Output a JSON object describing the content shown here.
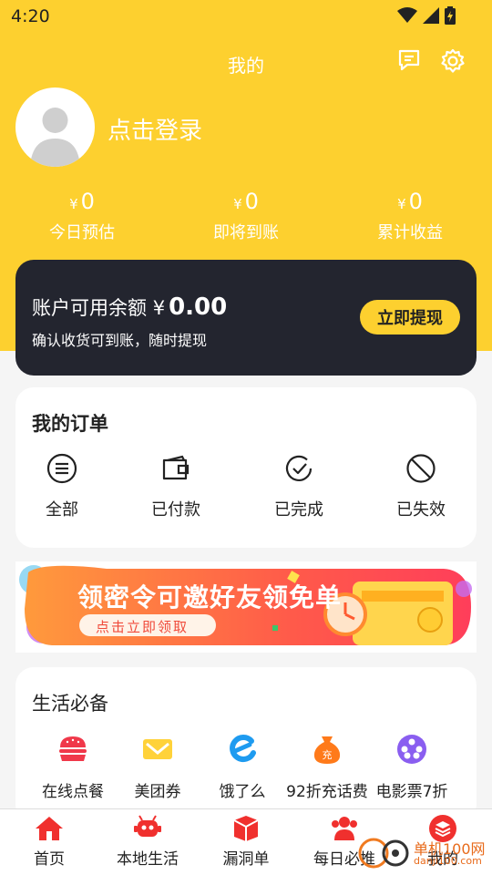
{
  "status_bar": {
    "time": "4:20"
  },
  "header": {
    "title": "我的"
  },
  "profile": {
    "login_text": "点击登录"
  },
  "stats": [
    {
      "currency": "¥",
      "value": "0",
      "label": "今日预估"
    },
    {
      "currency": "¥",
      "value": "0",
      "label": "即将到账"
    },
    {
      "currency": "¥",
      "value": "0",
      "label": "累计收益"
    }
  ],
  "balance": {
    "label": "账户可用余额",
    "currency": "¥",
    "amount": "0.00",
    "subtitle": "确认收货可到账，随时提现",
    "button": "立即提现"
  },
  "orders": {
    "title": "我的订单",
    "items": [
      {
        "label": "全部",
        "icon": "list-icon"
      },
      {
        "label": "已付款",
        "icon": "wallet-icon"
      },
      {
        "label": "已完成",
        "icon": "check-circle-icon"
      },
      {
        "label": "已失效",
        "icon": "ban-icon"
      }
    ]
  },
  "banner": {
    "headline": "领密令可邀好友领免单",
    "cta": "点击立即领取"
  },
  "life": {
    "title": "生活必备",
    "items": [
      {
        "label": "在线点餐",
        "icon": "burger-icon"
      },
      {
        "label": "美团券",
        "icon": "ticket-icon"
      },
      {
        "label": "饿了么",
        "icon": "eleme-icon"
      },
      {
        "label": "92折充话费",
        "icon": "recharge-bag-icon"
      },
      {
        "label": "电影票7折",
        "icon": "film-reel-icon"
      }
    ]
  },
  "tabs": [
    {
      "label": "首页",
      "icon": "home-icon"
    },
    {
      "label": "本地生活",
      "icon": "robot-icon"
    },
    {
      "label": "漏洞单",
      "icon": "gift-box-icon"
    },
    {
      "label": "每日必推",
      "icon": "users-icon"
    },
    {
      "label": "我的",
      "icon": "profile-stack-icon"
    }
  ],
  "colors": {
    "accent": "#fdd02f",
    "dark_card": "#23252f",
    "tab_icon": "#f0302e"
  },
  "watermark": {
    "text": "单机100网",
    "domain": "danji100.com"
  }
}
